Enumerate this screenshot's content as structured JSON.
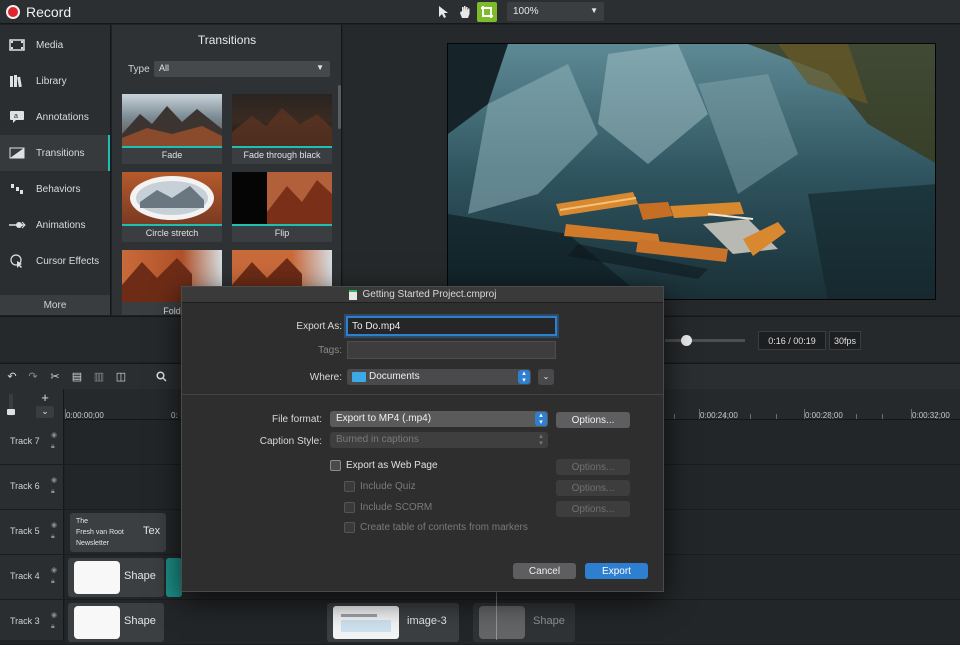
{
  "topbar": {
    "record_label": "Record",
    "zoom": "100%"
  },
  "sidebar": {
    "items": [
      {
        "label": "Media",
        "icon": "film-icon"
      },
      {
        "label": "Library",
        "icon": "library-icon"
      },
      {
        "label": "Annotations",
        "icon": "annotation-icon"
      },
      {
        "label": "Transitions",
        "icon": "transition-icon"
      },
      {
        "label": "Behaviors",
        "icon": "behavior-icon"
      },
      {
        "label": "Animations",
        "icon": "animation-icon"
      },
      {
        "label": "Cursor Effects",
        "icon": "cursor-icon"
      }
    ],
    "more_label": "More",
    "active": "Transitions"
  },
  "transitions": {
    "title": "Transitions",
    "type_label": "Type",
    "type_value": "All",
    "thumbs": [
      {
        "label": "Fade"
      },
      {
        "label": "Fade through black"
      },
      {
        "label": "Circle stretch"
      },
      {
        "label": "Flip"
      },
      {
        "label": "Fold"
      },
      {
        "label": ""
      }
    ]
  },
  "playback": {
    "time": "0:16 / 00:19",
    "fps": "30fps"
  },
  "timeline": {
    "ruler": [
      "0:00:00;00",
      "0:",
      "0:00:24;00",
      "0:00:28;00",
      "0:00:32;00"
    ],
    "tracks": [
      {
        "name": "Track 7"
      },
      {
        "name": "Track 6"
      },
      {
        "name": "Track 5"
      },
      {
        "name": "Track 4"
      },
      {
        "name": "Track 3"
      }
    ],
    "clips": {
      "newsletter_line1": "The",
      "newsletter_line2": "Fresh van Root",
      "newsletter_line3": "Newsletter",
      "text_clip": "Tex",
      "shape1": "Shape",
      "shape2": "Shape",
      "image3": "image-3",
      "shape3": "Shape"
    }
  },
  "dialog": {
    "title": "Getting Started Project.cmproj",
    "export_as_label": "Export As:",
    "export_as_value": "To Do.mp4",
    "tags_label": "Tags:",
    "tags_value": "",
    "where_label": "Where:",
    "where_value": "Documents",
    "file_format_label": "File format:",
    "file_format_value": "Export to MP4 (.mp4)",
    "options_label": "Options...",
    "caption_style_label": "Caption Style:",
    "caption_style_value": "Burned in captions",
    "web_page_label": "Export as Web Page",
    "include_quiz_label": "Include Quiz",
    "include_scorm_label": "Include SCORM",
    "toc_label": "Create table of contents from markers",
    "cancel_label": "Cancel",
    "export_label": "Export",
    "accent": "#2f7fd1"
  }
}
